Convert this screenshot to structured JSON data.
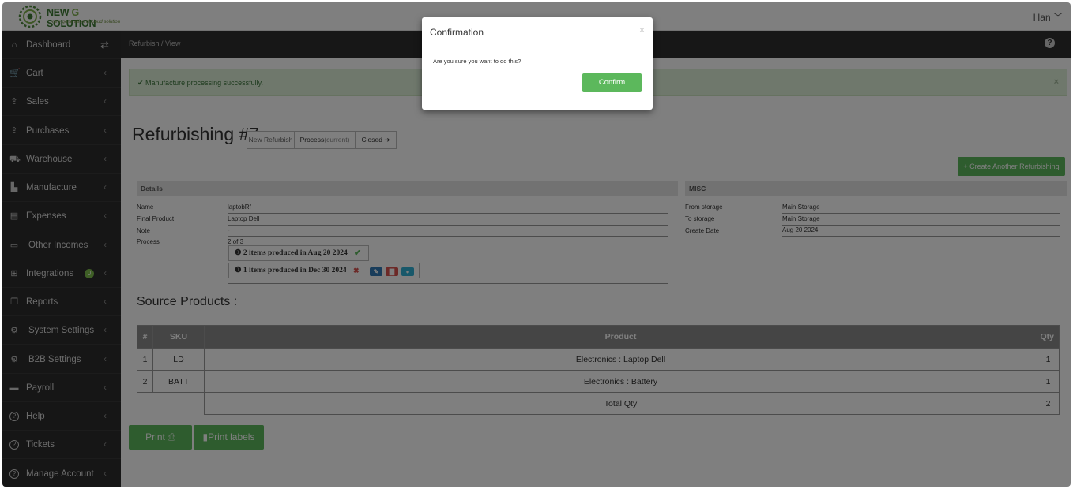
{
  "brand": {
    "name_part1": "NEW ",
    "name_part2": "G",
    "name_part3": " SOLUTION",
    "tagline": "new generation of cloud solution"
  },
  "user": {
    "name": "Han ﹀"
  },
  "sidebar": {
    "items": [
      {
        "label": "Dashboard",
        "icon": "home-icon"
      },
      {
        "label": "Cart",
        "icon": "cart-icon"
      },
      {
        "label": "Sales",
        "icon": "upload-icon"
      },
      {
        "label": "Purchases",
        "icon": "upload-icon"
      },
      {
        "label": "Warehouse",
        "icon": "truck-icon"
      },
      {
        "label": "Manufacture",
        "icon": "industry-icon"
      },
      {
        "label": "Expenses",
        "icon": "file-icon"
      },
      {
        "label": "Other Incomes",
        "icon": "money-icon"
      },
      {
        "label": "Integrations",
        "icon": "plug-icon",
        "badge": "0"
      },
      {
        "label": "Reports",
        "icon": "copy-icon"
      },
      {
        "label": "System Settings",
        "icon": "cogs-icon"
      },
      {
        "label": "B2B Settings",
        "icon": "cogs-icon"
      },
      {
        "label": "Payroll",
        "icon": "card-icon"
      },
      {
        "label": "Help",
        "icon": "help-icon"
      },
      {
        "label": "Tickets",
        "icon": "help-icon"
      },
      {
        "label": "Manage Account",
        "icon": "help-icon"
      }
    ],
    "chevron": "‹"
  },
  "breadcrumb": "Refurbish / View",
  "alert": {
    "text": "Manufacture processing successfully.",
    "close": "×"
  },
  "page": {
    "title": "Refurbishing #7",
    "steps": [
      "New Refurbish",
      "Process",
      "(current)",
      "Closed"
    ],
    "create_button": "Create Another Refurbishing"
  },
  "details": {
    "header": "Details",
    "fields": [
      {
        "label": "Name",
        "value": "laptobRf"
      },
      {
        "label": "Final Product",
        "value": "Laptop Dell"
      },
      {
        "label": "Note",
        "value": "-"
      },
      {
        "label": "Process",
        "value": "2 of 3"
      }
    ],
    "productions": [
      {
        "text": "2 items produced in Aug 20 2024",
        "status": "✔"
      },
      {
        "text": "1 items produced in Dec 30 2024",
        "status": "✖"
      }
    ]
  },
  "misc": {
    "header": "MISC",
    "fields": [
      {
        "label": "From storage",
        "value": "Main Storage"
      },
      {
        "label": "To storage",
        "value": "Main Storage"
      },
      {
        "label": "Create Date",
        "value": "Aug 20 2024"
      }
    ]
  },
  "source": {
    "title": "Source Products :",
    "columns": [
      "#",
      "SKU",
      "Product",
      "Qty"
    ],
    "rows": [
      [
        "1",
        "LD",
        "Electronics : Laptop Dell",
        "1"
      ],
      [
        "2",
        "BATT",
        "Electronics : Battery",
        "1"
      ]
    ],
    "total_label": "Total Qty",
    "total_value": "2"
  },
  "buttons": {
    "print": "Print",
    "print_labels": "Print labels"
  },
  "modal": {
    "title": "Confirmation",
    "close": "×",
    "body": "Are you sure you want to do this?",
    "confirm": "Confirm"
  },
  "colors": {
    "accent_green": "#5cb85c",
    "sidebar_bg": "#2c2c2c",
    "danger": "#d9534f",
    "info": "#31b0d5",
    "primary": "#337ab7"
  }
}
